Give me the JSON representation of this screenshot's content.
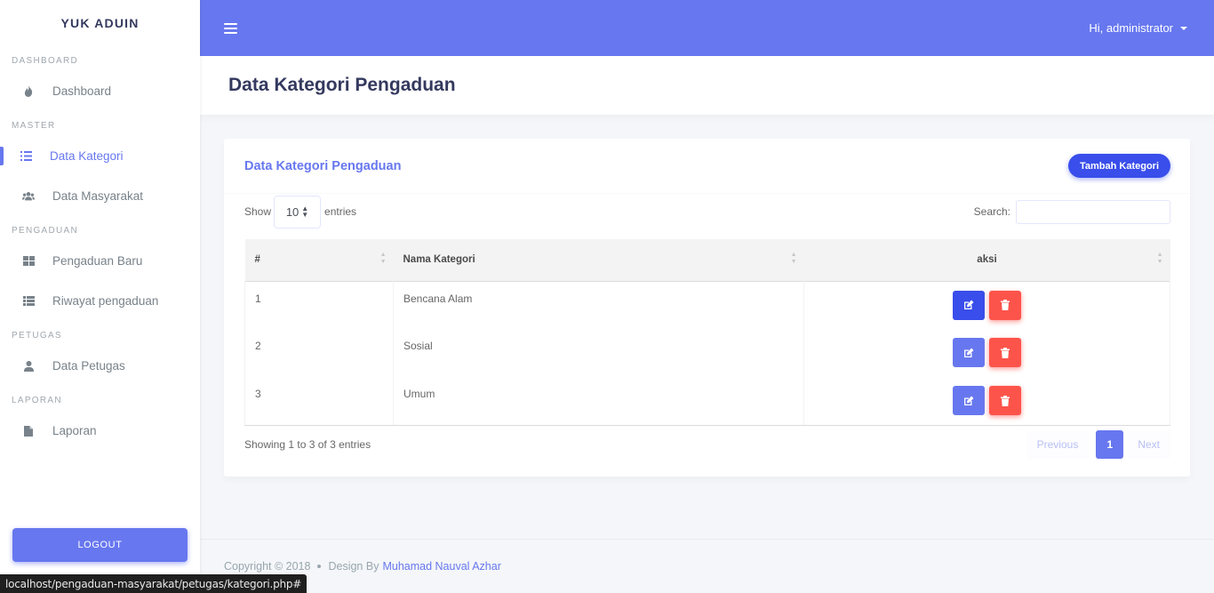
{
  "brand": "YUK ADUIN",
  "sidebar": {
    "sections": [
      {
        "header": "DASHBOARD",
        "items": [
          {
            "label": "Dashboard",
            "icon": "fire-icon"
          }
        ]
      },
      {
        "header": "MASTER",
        "items": [
          {
            "label": "Data Kategori",
            "icon": "list-icon",
            "active": true
          },
          {
            "label": "Data Masyarakat",
            "icon": "users-icon"
          }
        ]
      },
      {
        "header": "PENGADUAN",
        "items": [
          {
            "label": "Pengaduan Baru",
            "icon": "grid-icon"
          },
          {
            "label": "Riwayat pengaduan",
            "icon": "table-icon"
          }
        ]
      },
      {
        "header": "PETUGAS",
        "items": [
          {
            "label": "Data Petugas",
            "icon": "user-icon"
          }
        ]
      },
      {
        "header": "LAPORAN",
        "items": [
          {
            "label": "Laporan",
            "icon": "file-icon"
          }
        ]
      }
    ],
    "logout_label": "LOGOUT"
  },
  "navbar": {
    "user_greeting": "Hi, administrator"
  },
  "page": {
    "title": "Data Kategori Pengaduan"
  },
  "card": {
    "title": "Data Kategori Pengaduan",
    "add_button": "Tambah Kategori",
    "show_label": "Show",
    "entries_value": "10",
    "entries_label": "entries",
    "search_label": "Search:",
    "search_value": "",
    "columns": [
      "#",
      "Nama Kategori",
      "aksi"
    ],
    "rows": [
      {
        "no": "1",
        "name": "Bencana Alam"
      },
      {
        "no": "2",
        "name": "Sosial"
      },
      {
        "no": "3",
        "name": "Umum"
      }
    ],
    "info": "Showing 1 to 3 of 3 entries",
    "pagination": {
      "previous": "Previous",
      "current": "1",
      "next": "Next"
    }
  },
  "footer": {
    "copyright": "Copyright © 2018",
    "design_by": "Design By",
    "author": "Muhamad Nauval Azhar"
  },
  "statusbar": {
    "url": "localhost/pengaduan-masyarakat/petugas/kategori.php#"
  },
  "colors": {
    "primary": "#6777ef",
    "danger": "#fc544b",
    "sidebar_bg": "#ffffff",
    "body_bg": "#f4f6f9"
  }
}
